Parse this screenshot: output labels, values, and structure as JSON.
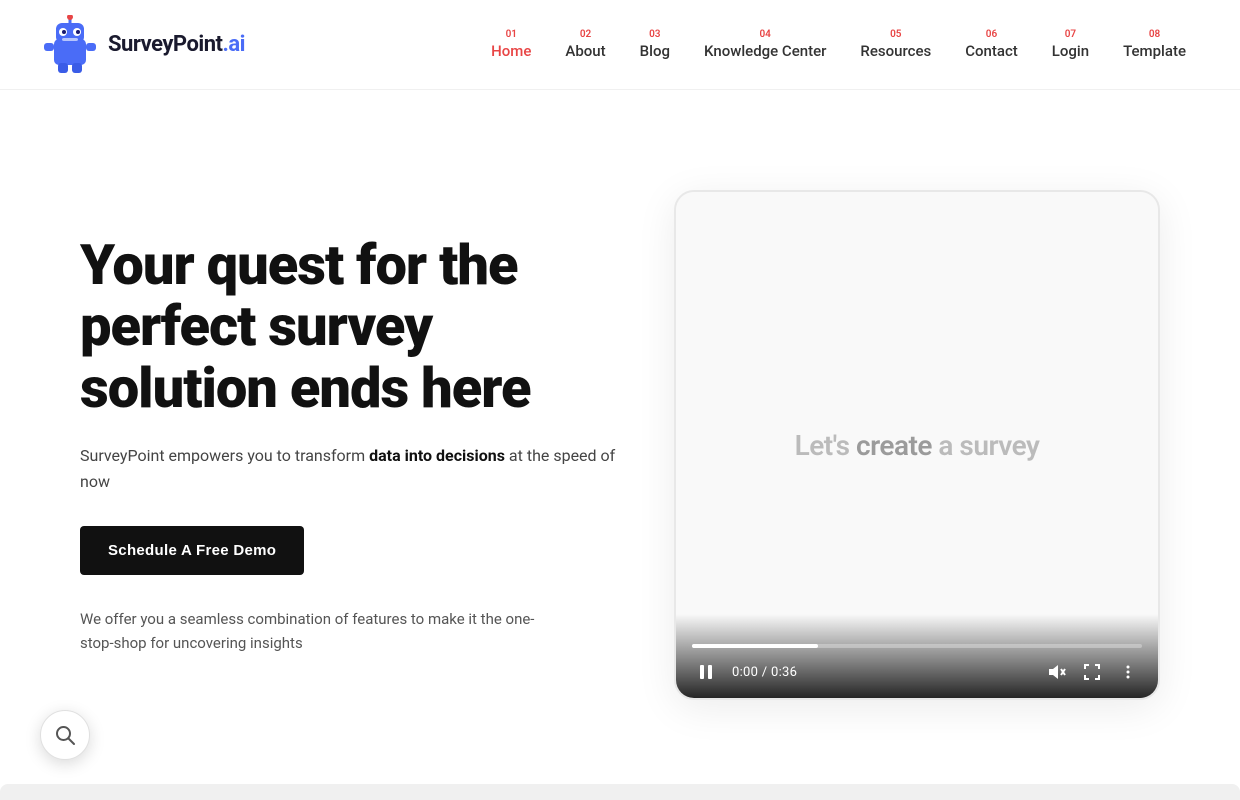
{
  "brand": {
    "name": "SurveyPoint",
    "ai_suffix": ".ai",
    "logo_alt": "SurveyPoint robot logo"
  },
  "nav": {
    "items": [
      {
        "num": "01",
        "label": "Home",
        "active": true
      },
      {
        "num": "02",
        "label": "About",
        "active": false
      },
      {
        "num": "03",
        "label": "Blog",
        "active": false
      },
      {
        "num": "04",
        "label": "Knowledge Center",
        "active": false
      },
      {
        "num": "05",
        "label": "Resources",
        "active": false
      },
      {
        "num": "06",
        "label": "Contact",
        "active": false
      },
      {
        "num": "07",
        "label": "Login",
        "active": false
      },
      {
        "num": "08",
        "label": "Template",
        "active": false
      }
    ]
  },
  "hero": {
    "title": "Your quest for the perfect survey solution ends here",
    "subtitle_plain": "SurveyPoint empowers you to transform ",
    "subtitle_bold": "data into decisions",
    "subtitle_end": " at the speed of now",
    "cta_label": "Schedule A Free Demo",
    "description": "We offer you a seamless combination of features to make it the one-stop-shop for uncovering insights"
  },
  "video": {
    "overlay_text_plain": "Let's ",
    "overlay_text_highlight": "create",
    "overlay_text_end": " a survey",
    "time_display": "0:00 / 0:36",
    "progress_percent": 28
  },
  "search_fab": {
    "icon": "search"
  }
}
